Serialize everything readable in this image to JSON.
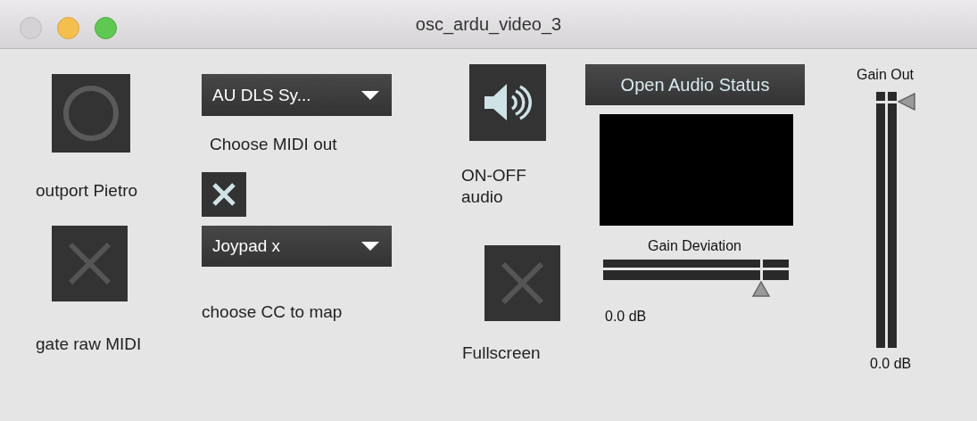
{
  "window": {
    "title": "osc_ardu_video_3"
  },
  "bang": {
    "label": "outport Pietro"
  },
  "midi_out_menu": {
    "value": "AU DLS Sy...",
    "caption": "Choose MIDI out"
  },
  "midi_toggle": {
    "checked": true
  },
  "gate_toggle": {
    "checked": false,
    "label": "gate raw MIDI"
  },
  "cc_menu": {
    "value": "Joypad x",
    "caption": "choose CC to map"
  },
  "audio_toggle": {
    "label": "ON-OFF audio"
  },
  "fullscreen_toggle": {
    "checked": false,
    "label": "Fullscreen"
  },
  "audio_status_button": {
    "label": "Open Audio Status"
  },
  "gain_deviation": {
    "label": "Gain Deviation",
    "level": 0.85,
    "reading": "0.0 dB"
  },
  "gain_out": {
    "label": "Gain Out",
    "level": 0.96,
    "reading": "0.0 dB"
  }
}
